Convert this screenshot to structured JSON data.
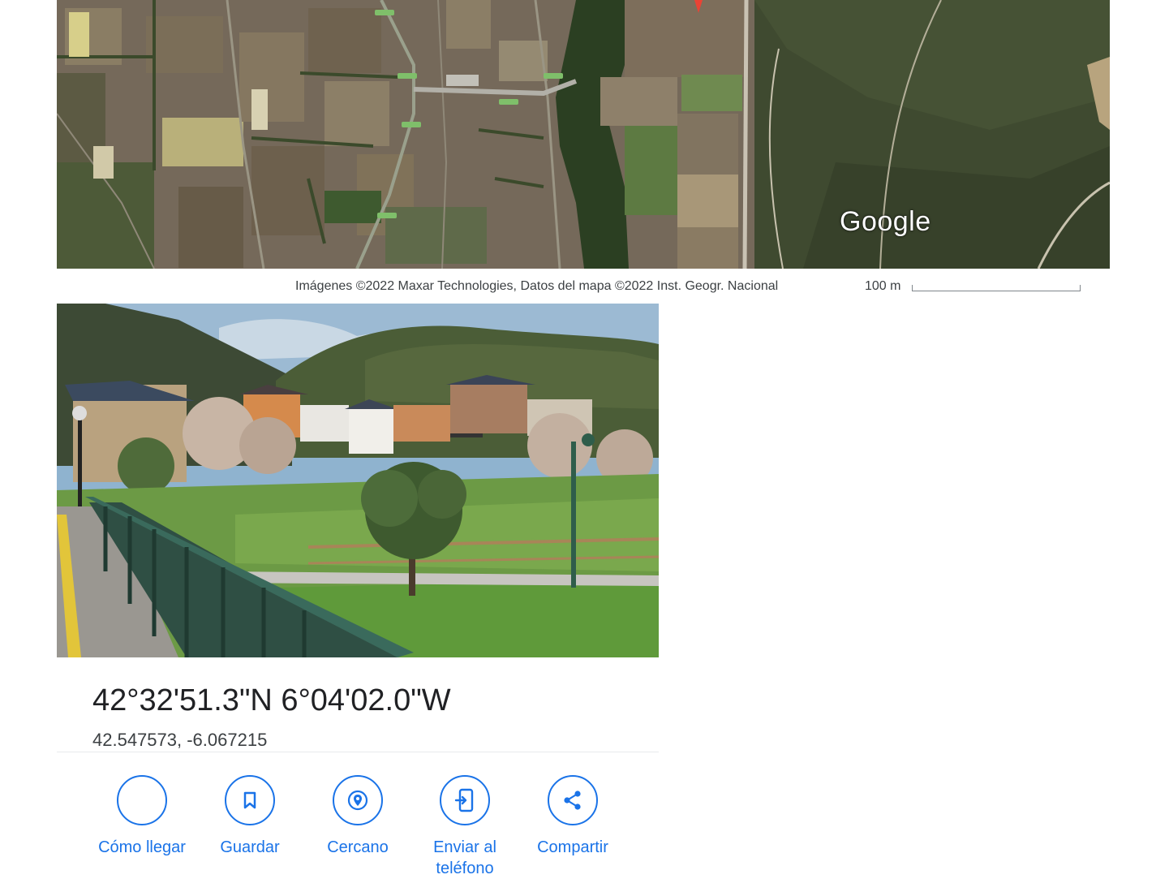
{
  "map": {
    "logo_text": "Google",
    "attribution": "Imágenes ©2022 Maxar Technologies, Datos del mapa ©2022 Inst. Geogr. Nacional",
    "scale_label": "100 m",
    "marker_color": "#ea4335"
  },
  "place": {
    "coords_dms": "42°32'51.3\"N 6°04'02.0\"W",
    "coords_decimal": "42.547573, -6.067215"
  },
  "actions": [
    {
      "label": "Cómo llegar",
      "icon": "directions-icon"
    },
    {
      "label": "Guardar",
      "icon": "bookmark-icon"
    },
    {
      "label": "Cercano",
      "icon": "nearby-icon"
    },
    {
      "label": "Enviar al teléfono",
      "icon": "send-to-phone-icon"
    },
    {
      "label": "Compartir",
      "icon": "share-icon"
    }
  ],
  "colors": {
    "accent": "#1a73e8",
    "text": "#202124"
  }
}
